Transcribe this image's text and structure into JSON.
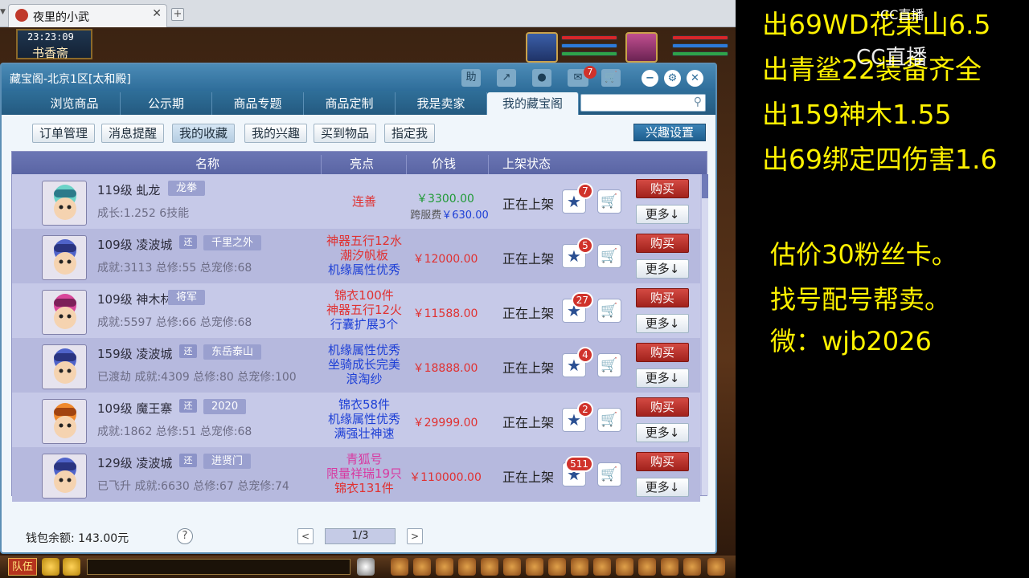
{
  "browser": {
    "tab_title": "夜里的小武",
    "close_glyph": "✕",
    "newtab_glyph": "+"
  },
  "scene": {
    "clock_time": "23:23:09",
    "location": "书香斋"
  },
  "dialog": {
    "title": "藏宝阁-北京1区[太和殿]",
    "help_label": "助",
    "mail_badge": "7",
    "nav_tabs": [
      "浏览商品",
      "公示期",
      "商品专题",
      "商品定制",
      "我是卖家",
      "我的藏宝阁"
    ],
    "active_tab": "我的藏宝阁",
    "sub_buttons": [
      "订单管理",
      "消息提醒",
      "我的收藏",
      "我的兴趣",
      "买到物品",
      "指定我"
    ],
    "selected_sub": "我的收藏",
    "interest_button": "兴趣设置",
    "columns": [
      "名称",
      "亮点",
      "价钱",
      "上架状态"
    ],
    "buy_label": "购买",
    "more_label": "更多↓",
    "huan_label": "还",
    "rows": [
      {
        "level_name": "119级 虬龙",
        "tag": "龙拳",
        "huan": false,
        "info": "成长:1.252 6技能",
        "highlights": [
          {
            "text": "连善",
            "color": "r"
          }
        ],
        "price": "￥3300.00",
        "price_green": true,
        "fee_label": "跨服费",
        "fee_value": "￥630.00",
        "status": "正在上架",
        "favorites": "7",
        "avatar": "dragon"
      },
      {
        "level_name": "109级 凌波城",
        "tag": "千里之外",
        "huan": true,
        "info": "成就:3113 总修:55 总宠修:68",
        "highlights": [
          {
            "text": "神器五行12水",
            "color": "r"
          },
          {
            "text": "潮汐帆板",
            "color": "r"
          },
          {
            "text": "机缘属性优秀",
            "color": "b"
          }
        ],
        "price": "￥12000.00",
        "price_green": false,
        "status": "正在上架",
        "favorites": "5",
        "avatar": "blue"
      },
      {
        "level_name": "109级 神木林",
        "tag": "将军",
        "huan": false,
        "info": "成就:5597 总修:66 总宠修:68",
        "highlights": [
          {
            "text": "锦衣100件",
            "color": "r"
          },
          {
            "text": "神器五行12火",
            "color": "r"
          },
          {
            "text": "行囊扩展3个",
            "color": "b"
          }
        ],
        "price": "￥11588.00",
        "price_green": false,
        "status": "正在上架",
        "favorites": "27",
        "avatar": "pink"
      },
      {
        "level_name": "159级 凌波城",
        "tag": "东岳泰山",
        "huan": true,
        "info": "已渡劫 成就:4309 总修:80 总宠修:100",
        "highlights": [
          {
            "text": "机缘属性优秀",
            "color": "b"
          },
          {
            "text": "坐骑成长完美",
            "color": "b"
          },
          {
            "text": "浪淘纱",
            "color": "b"
          }
        ],
        "price": "￥18888.00",
        "price_green": false,
        "status": "正在上架",
        "favorites": "4",
        "avatar": "blue"
      },
      {
        "level_name": "109级 魔王寨",
        "tag": "2020",
        "huan": true,
        "info": "成就:1862 总修:51 总宠修:68",
        "highlights": [
          {
            "text": "锦衣58件",
            "color": "b"
          },
          {
            "text": "机缘属性优秀",
            "color": "b"
          },
          {
            "text": "满强壮神速",
            "color": "b"
          }
        ],
        "price": "￥29999.00",
        "price_green": false,
        "status": "正在上架",
        "favorites": "2",
        "avatar": "orange"
      },
      {
        "level_name": "129级 凌波城",
        "tag": "进贤门",
        "huan": true,
        "info": "已飞升 成就:6630 总修:67 总宠修:74",
        "highlights": [
          {
            "text": "青狐号",
            "color": "p"
          },
          {
            "text": "限量祥瑞19只",
            "color": "p"
          },
          {
            "text": "锦衣131件",
            "color": "r"
          }
        ],
        "price": "￥110000.00",
        "price_green": false,
        "status": "正在上架",
        "favorites": "511",
        "avatar": "blue"
      }
    ],
    "wallet": "钱包余额: 143.00元",
    "help_icon": "?",
    "prev": "<",
    "next": ">",
    "page": "1/3"
  },
  "hotbar": {
    "team_label": "队伍"
  },
  "overlay": {
    "lines": [
      "出69WD花果山6.5",
      "出青鲨22装备齐全",
      "出159神木1.55",
      "出69绑定四伤害1.6"
    ],
    "lines2": [
      "估价30粉丝卡。",
      "找号配号帮卖。",
      "微：wjb2026"
    ],
    "logo_small": "CC直播",
    "logo_big": "CC直播"
  },
  "colors": {
    "overlay_text": "#fff200",
    "title_bar": "#2e6d9a",
    "buy_button": "#a1221c",
    "price_red": "#e03131",
    "price_green": "#1f9a35"
  }
}
